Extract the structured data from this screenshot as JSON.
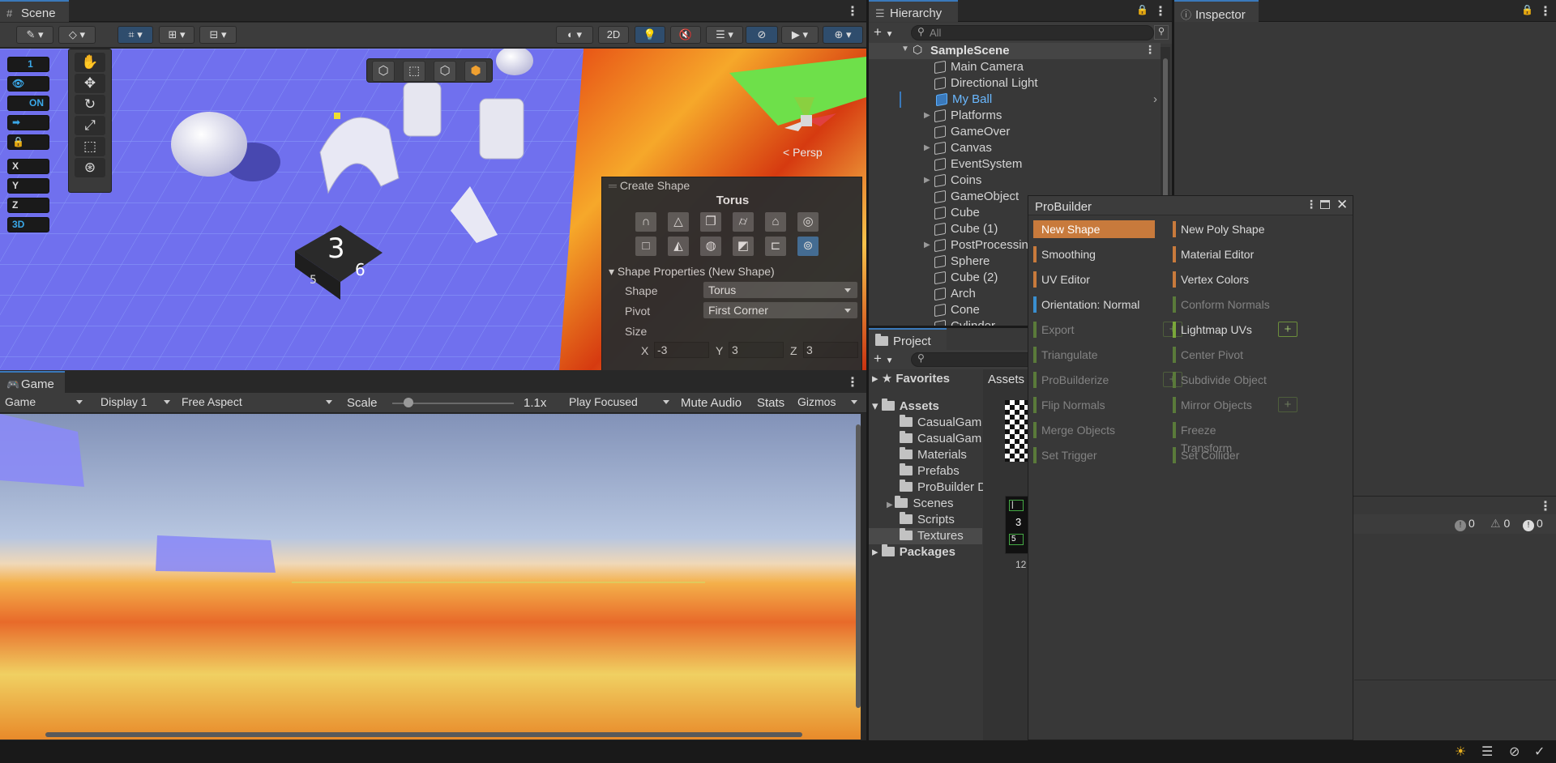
{
  "scene": {
    "tab": "Scene",
    "tb_2d": "2D",
    "persp": "< Persp",
    "overlay": [
      "1",
      "ON",
      "X",
      "Y",
      "Z",
      "3D"
    ],
    "create_shape": {
      "title": "Create Shape",
      "shape_name": "Torus",
      "props_title": "Shape Properties (New Shape)",
      "shape_label": "Shape",
      "shape_value": "Torus",
      "pivot_label": "Pivot",
      "pivot_value": "First Corner",
      "size_label": "Size",
      "x_label": "X",
      "x_value": "-3",
      "y_label": "Y",
      "y_value": "3",
      "z_label": "Z",
      "z_value": "3"
    },
    "cube_digit": "3",
    "cube_digit2": "6",
    "cube_digit3": "5"
  },
  "game": {
    "tab": "Game",
    "mode": "Game",
    "display": "Display 1",
    "aspect": "Free Aspect",
    "scale_label": "Scale",
    "scale_value": "1.1x",
    "scale_fraction": 0.1,
    "play": "Play Focused",
    "mute": "Mute Audio",
    "stats": "Stats",
    "gizmos": "Gizmos"
  },
  "hierarchy": {
    "tab": "Hierarchy",
    "search_placeholder": "All",
    "scene_name": "SampleScene",
    "items": [
      {
        "label": "Main Camera",
        "expand": false,
        "selected": false
      },
      {
        "label": "Directional Light",
        "expand": false,
        "selected": false
      },
      {
        "label": "My Ball",
        "expand": false,
        "selected": true
      },
      {
        "label": "Platforms",
        "expand": true,
        "selected": false
      },
      {
        "label": "GameOver",
        "expand": false,
        "selected": false
      },
      {
        "label": "Canvas",
        "expand": true,
        "selected": false
      },
      {
        "label": "EventSystem",
        "expand": false,
        "selected": false
      },
      {
        "label": "Coins",
        "expand": true,
        "selected": false
      },
      {
        "label": "GameObject",
        "expand": false,
        "selected": false
      },
      {
        "label": "Cube",
        "expand": false,
        "selected": false
      },
      {
        "label": "Cube (1)",
        "expand": false,
        "selected": false
      },
      {
        "label": "PostProcessin",
        "expand": true,
        "selected": false
      },
      {
        "label": "Sphere",
        "expand": false,
        "selected": false
      },
      {
        "label": "Cube (2)",
        "expand": false,
        "selected": false
      },
      {
        "label": "Arch",
        "expand": false,
        "selected": false
      },
      {
        "label": "Cone",
        "expand": false,
        "selected": false
      },
      {
        "label": "Cylinder",
        "expand": false,
        "selected": false
      }
    ]
  },
  "inspector": {
    "tab": "Inspector"
  },
  "project": {
    "tab": "Project",
    "favorites": "Favorites",
    "assets": "Assets",
    "assets_crumb": "Assets",
    "folders": [
      "CasualGam",
      "CasualGam",
      "Materials",
      "Prefabs",
      "ProBuilder D",
      "Scenes",
      "Scripts",
      "Textures"
    ],
    "packages": "Packages",
    "asset_label": "12"
  },
  "console": {
    "errors": "0",
    "warnings": "0",
    "messages": "0"
  },
  "probuilder": {
    "title": "ProBuilder",
    "left": [
      {
        "label": "New Shape",
        "color": "#c87a3c",
        "dim": false,
        "selected": true,
        "plus": false
      },
      {
        "label": "Smoothing",
        "color": "#c87a3c",
        "dim": false,
        "selected": false,
        "plus": false
      },
      {
        "label": "UV Editor",
        "color": "#c87a3c",
        "dim": false,
        "selected": false,
        "plus": false
      },
      {
        "label": "Orientation: Normal",
        "color": "#3a8fd0",
        "dim": false,
        "selected": false,
        "plus": false
      },
      {
        "label": "Export",
        "color": "#5a7a3a",
        "dim": true,
        "selected": false,
        "plus": true
      },
      {
        "label": "Triangulate",
        "color": "#5a7a3a",
        "dim": true,
        "selected": false,
        "plus": false
      },
      {
        "label": "ProBuilderize",
        "color": "#5a7a3a",
        "dim": true,
        "selected": false,
        "plus": true
      },
      {
        "label": "Flip Normals",
        "color": "#5a7a3a",
        "dim": true,
        "selected": false,
        "plus": false
      },
      {
        "label": "Merge Objects",
        "color": "#5a7a3a",
        "dim": true,
        "selected": false,
        "plus": false
      },
      {
        "label": "Set Trigger",
        "color": "#5a7a3a",
        "dim": true,
        "selected": false,
        "plus": false
      }
    ],
    "right": [
      {
        "label": "New Poly Shape",
        "color": "#c87a3c",
        "dim": false,
        "plus": false
      },
      {
        "label": "Material Editor",
        "color": "#c87a3c",
        "dim": false,
        "plus": false
      },
      {
        "label": "Vertex Colors",
        "color": "#c87a3c",
        "dim": false,
        "plus": false
      },
      {
        "label": "Conform Normals",
        "color": "#5a7a3a",
        "dim": true,
        "plus": false
      },
      {
        "label": "Lightmap UVs",
        "color": "#7aa83a",
        "dim": false,
        "plus": true
      },
      {
        "label": "Center Pivot",
        "color": "#5a7a3a",
        "dim": true,
        "plus": false
      },
      {
        "label": "Subdivide Object",
        "color": "#5a7a3a",
        "dim": true,
        "plus": false
      },
      {
        "label": "Mirror Objects",
        "color": "#5a7a3a",
        "dim": true,
        "plus": true
      },
      {
        "label": "Freeze Transform",
        "color": "#5a7a3a",
        "dim": true,
        "plus": false
      },
      {
        "label": "Set Collider",
        "color": "#5a7a3a",
        "dim": true,
        "plus": false
      }
    ]
  }
}
